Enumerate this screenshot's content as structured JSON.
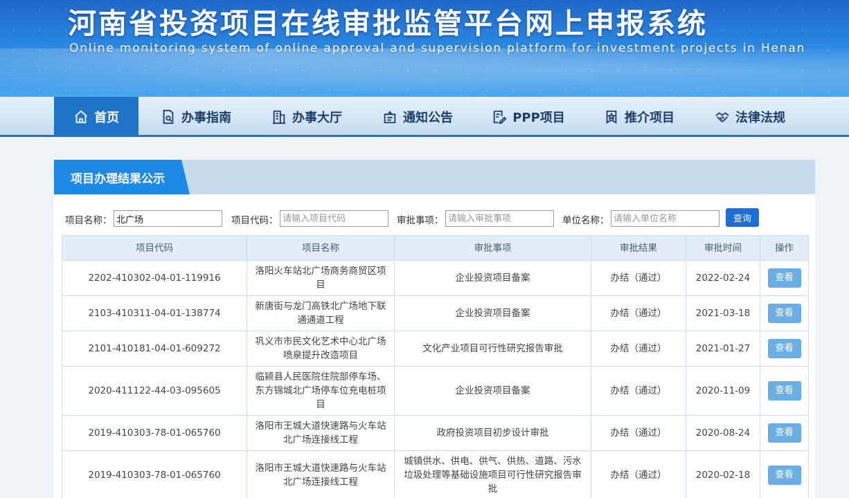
{
  "banner": {
    "title": "河南省投资项目在线审批监管平台网上申报系统",
    "subtitle": "Online monitoring system of online approval and supervision platform for investment projects in Henan"
  },
  "nav": {
    "items": [
      {
        "label": "首页",
        "icon": "home-icon",
        "active": true
      },
      {
        "label": "办事指南",
        "icon": "guide-doc-icon"
      },
      {
        "label": "办事大厅",
        "icon": "building-icon"
      },
      {
        "label": "通知公告",
        "icon": "notice-icon"
      },
      {
        "label": "PPP项目",
        "icon": "edit-doc-icon"
      },
      {
        "label": "推介项目",
        "icon": "star-badge-icon"
      },
      {
        "label": "法律法规",
        "icon": "handshake-icon"
      }
    ]
  },
  "panel": {
    "title": "项目办理结果公示"
  },
  "search": {
    "name_label": "项目名称：",
    "name_value": "北广场",
    "code_label": "项目代码：",
    "code_placeholder": "请输入项目代码",
    "item_label": "审批事项：",
    "item_placeholder": "请输入审批事项",
    "unit_label": "单位名称：",
    "unit_placeholder": "请输入单位名称",
    "button": "查询"
  },
  "table": {
    "headers": [
      "项目代码",
      "项目名称",
      "审批事项",
      "审批结果",
      "审批时间",
      "操作"
    ],
    "action_label": "查看",
    "rows": [
      {
        "code": "2202-410302-04-01-119916",
        "name": "洛阳火车站北广场商务商贸区项目",
        "item": "企业投资项目备案",
        "result": "办结（通过）",
        "date": "2022-02-24"
      },
      {
        "code": "2103-410311-04-01-138774",
        "name": "新唐街与龙门高铁北广场地下联通通道工程",
        "item": "企业投资项目备案",
        "result": "办结（通过）",
        "date": "2021-03-18"
      },
      {
        "code": "2101-410181-04-01-609272",
        "name": "巩义市市民文化艺术中心北广场喷泉提升改造项目",
        "item": "文化产业项目可行性研究报告审批",
        "result": "办结（通过）",
        "date": "2021-01-27"
      },
      {
        "code": "2020-411122-44-03-095605",
        "name": "临颍县人民医院住院部停车场、东方锦城北广场停车位充电桩项目",
        "item": "企业投资项目备案",
        "result": "办结（通过）",
        "date": "2020-11-09"
      },
      {
        "code": "2019-410303-78-01-065760",
        "name": "洛阳市王城大道快速路与火车站北广场连接线工程",
        "item": "政府投资项目初步设计审批",
        "result": "办结（通过）",
        "date": "2020-08-24"
      },
      {
        "code": "2019-410303-78-01-065760",
        "name": "洛阳市王城大道快速路与火车站北广场连接线工程",
        "item": "城镇供水、供电、供气、供热、道路、污水垃圾处理等基础设施项目可行性研究报告审批",
        "result": "办结（通过）",
        "date": "2020-02-18"
      }
    ]
  }
}
